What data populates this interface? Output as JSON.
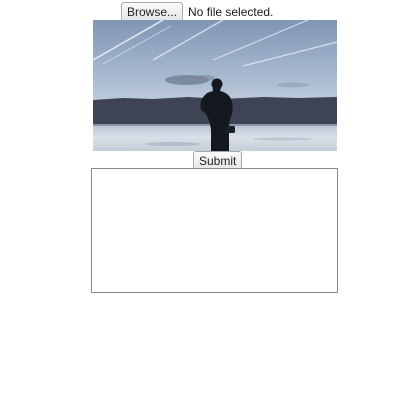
{
  "file_input": {
    "browse_label": "Browse...",
    "status_text": "No file selected."
  },
  "submit": {
    "label": "Submit"
  },
  "image": {
    "subject": "silhouette-figure-at-lakeshore-dusk"
  },
  "colors": {
    "button_bg": "#ececec",
    "button_border": "#a9a9a9",
    "box_border": "#8a8a8a"
  }
}
